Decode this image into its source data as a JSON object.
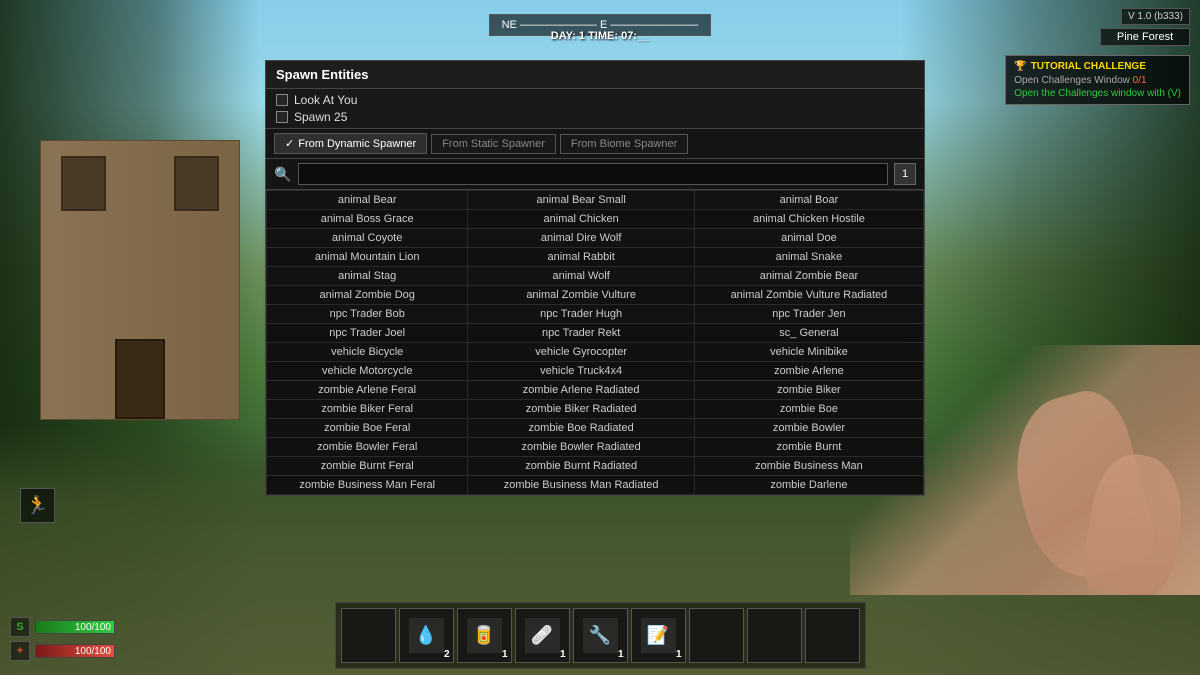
{
  "game": {
    "version": "V 1.0 (b333)",
    "biome": "Pine Forest",
    "compass": "NE ——————— E ————————",
    "day_time": "DAY: 1 TIME: 07:__"
  },
  "tutorial": {
    "title": "TUTORIAL CHALLENGE",
    "items": [
      {
        "label": "Open Challenges Window",
        "progress": "0/1"
      },
      {
        "label": "Open the Challenges window with (V)"
      }
    ]
  },
  "spawn_panel": {
    "title": "Spawn Entities",
    "option1": "Look At You",
    "option2": "Spawn 25",
    "spawner_buttons": [
      {
        "label": "From Dynamic Spawner",
        "active": true
      },
      {
        "label": "From Static Spawner",
        "active": false
      },
      {
        "label": "From Biome Spawner",
        "active": false
      }
    ],
    "search_placeholder": "",
    "list_count": "1",
    "entities": [
      [
        "animal Bear",
        "animal Bear Small",
        "animal Boar"
      ],
      [
        "animal Boss Grace",
        "animal Chicken",
        "animal Chicken Hostile"
      ],
      [
        "animal Coyote",
        "animal Dire Wolf",
        "animal Doe"
      ],
      [
        "animal Mountain Lion",
        "animal Rabbit",
        "animal Snake"
      ],
      [
        "animal Stag",
        "animal Wolf",
        "animal Zombie Bear"
      ],
      [
        "animal Zombie Dog",
        "animal Zombie Vulture",
        "animal Zombie Vulture Radiated"
      ],
      [
        "npc Trader Bob",
        "npc Trader Hugh",
        "npc Trader Jen"
      ],
      [
        "npc Trader Joel",
        "npc Trader Rekt",
        "sc_ General"
      ],
      [
        "vehicle Bicycle",
        "vehicle Gyrocopter",
        "vehicle Minibike"
      ],
      [
        "vehicle Motorcycle",
        "vehicle Truck4x4",
        "zombie Arlene"
      ],
      [
        "zombie Arlene Feral",
        "zombie Arlene Radiated",
        "zombie Biker"
      ],
      [
        "zombie Biker Feral",
        "zombie Biker Radiated",
        "zombie Boe"
      ],
      [
        "zombie Boe Feral",
        "zombie Boe Radiated",
        "zombie Bowler"
      ],
      [
        "zombie Bowler Feral",
        "zombie Bowler Radiated",
        "zombie Burnt"
      ],
      [
        "zombie Burnt Feral",
        "zombie Burnt Radiated",
        "zombie Business Man"
      ],
      [
        "zombie Business Man Feral",
        "zombie Business Man Radiated",
        "zombie Darlene"
      ]
    ]
  },
  "hud": {
    "stamina_label": "🏃",
    "health_label": "❤",
    "stamina_value": "100/100",
    "health_value": "100/100",
    "stamina_pct": 100,
    "health_pct": 100
  },
  "hotbar": {
    "slots": [
      {
        "has_item": false,
        "count": ""
      },
      {
        "has_item": true,
        "icon": "💧",
        "count": "2"
      },
      {
        "has_item": true,
        "icon": "🥫",
        "count": "1"
      },
      {
        "has_item": true,
        "icon": "🩹",
        "count": "1"
      },
      {
        "has_item": true,
        "icon": "🔧",
        "count": "1"
      },
      {
        "has_item": true,
        "icon": "📝",
        "count": "1"
      },
      {
        "has_item": false,
        "count": ""
      },
      {
        "has_item": false,
        "count": ""
      },
      {
        "has_item": false,
        "count": ""
      }
    ]
  }
}
